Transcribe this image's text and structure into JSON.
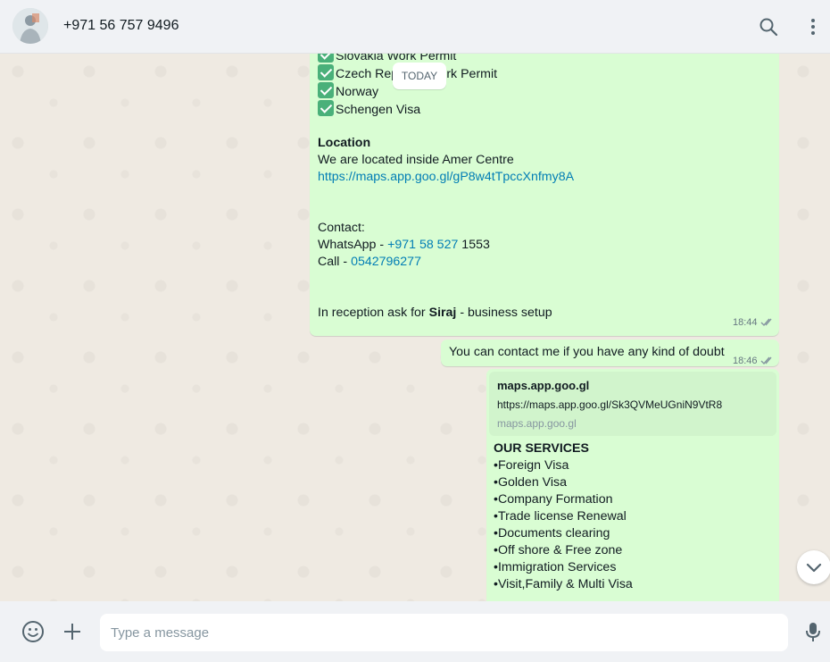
{
  "header": {
    "contact_name": "+971 56 757 9496",
    "icons": [
      "avatar",
      "search-icon",
      "menu-icon"
    ]
  },
  "chat": {
    "date_divider": "TODAY",
    "message1": {
      "list": [
        "Slovakia Work Permit",
        "Czech Republic Work Permit",
        "Norway",
        "Schengen Visa"
      ],
      "location_heading": "Location",
      "location_text": "We are located inside Amer Centre",
      "location_link": "https://maps.app.goo.gl/gP8w4tTpccXnfmy8A",
      "contact_heading": "Contact:",
      "whatsapp_prefix": "WhatsApp - ",
      "whatsapp_number": "+971 58 527",
      "whatsapp_suffix": " 1553",
      "call_prefix": "Call - ",
      "call_number": "0542796277",
      "reception_prefix": "In reception ask for ",
      "reception_name": "Siraj",
      "reception_suffix": " - business setup",
      "time": "18:44"
    },
    "message2": {
      "text": "You can contact me if you have any kind of doubt",
      "time": "18:46"
    },
    "message3": {
      "preview_title": "maps.app.goo.gl",
      "preview_url": "https://maps.app.goo.gl/Sk3QVMeUGniN9VtR8",
      "preview_domain": "maps.app.goo.gl",
      "services_heading": "OUR SERVICES",
      "services": [
        "•Foreign Visa",
        "•Golden Visa",
        "•Company Formation",
        "•Trade license Renewal",
        "•Documents clearing",
        "•Off shore & Free zone",
        "•Immigration Services",
        "•Visit,Family & Multi Visa"
      ]
    }
  },
  "footer": {
    "placeholder": "Type a message"
  },
  "colors": {
    "outgoing_bubble": "#d9fdd3",
    "link": "#027eb5",
    "chat_background": "#efeae2",
    "header_background": "#f0f2f5"
  }
}
